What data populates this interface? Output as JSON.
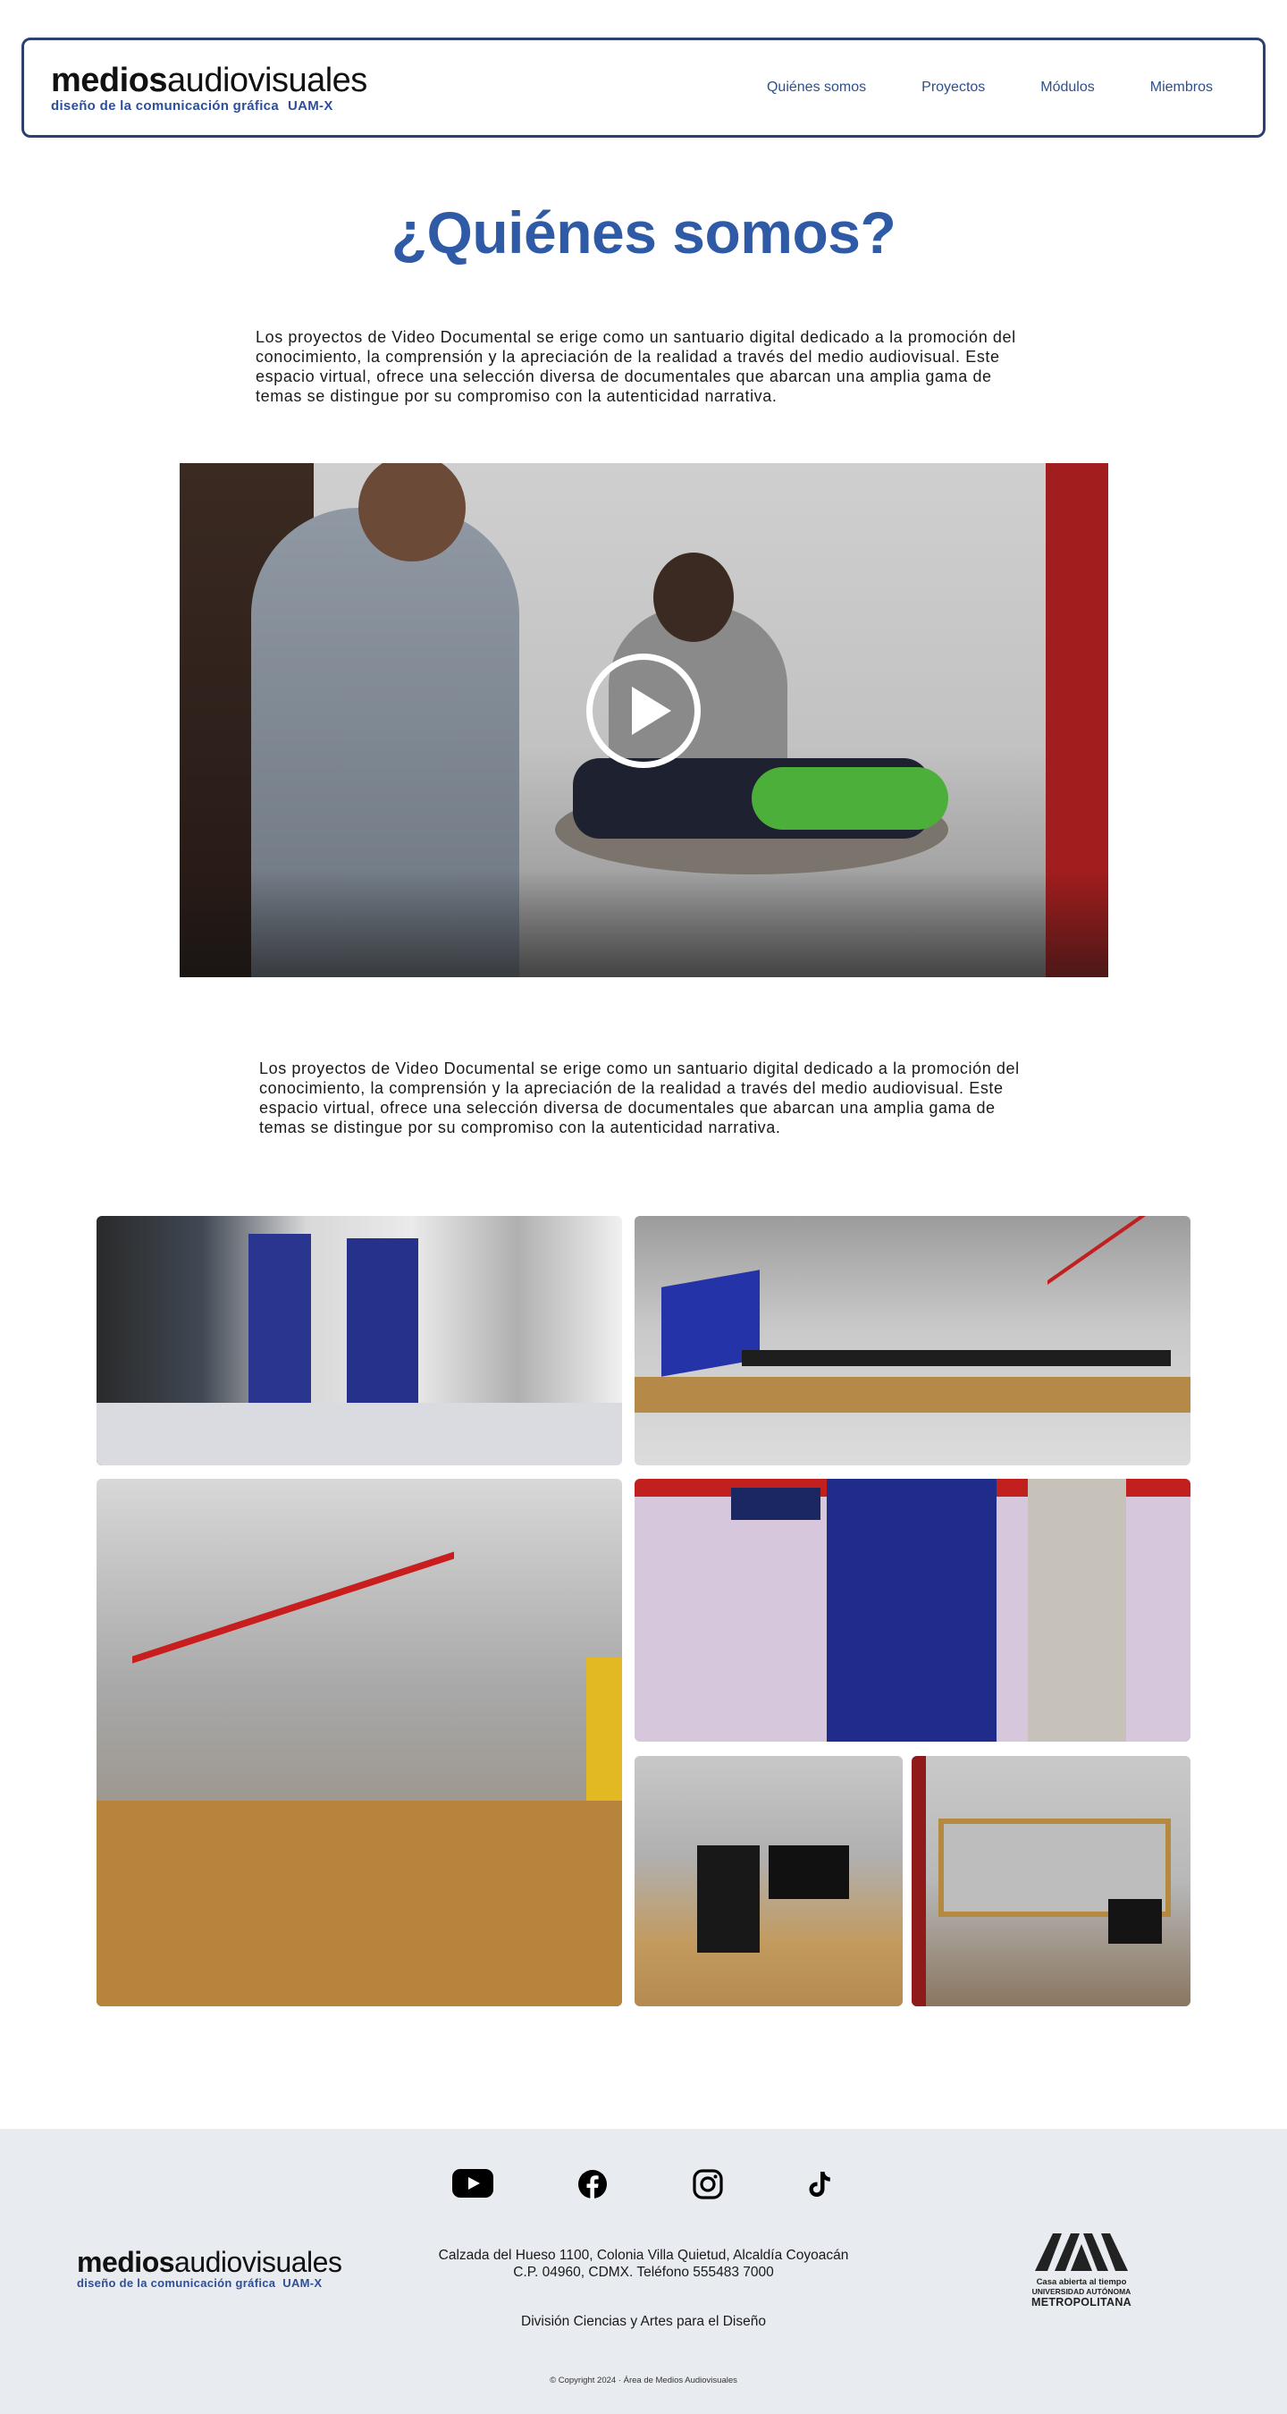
{
  "header": {
    "logo_bold": "medios",
    "logo_light": "audiovisuales",
    "logo_sub": "diseño de la comunicación gráfica",
    "logo_sub2": "UAM-X",
    "nav": [
      {
        "label": "Quiénes somos"
      },
      {
        "label": "Proyectos"
      },
      {
        "label": "Módulos"
      },
      {
        "label": "Miembros"
      }
    ]
  },
  "main": {
    "title": "¿Quiénes somos?",
    "paragraph_1": "Los proyectos de Video Documental se erige como un santuario digital dedicado a la promoción del conocimiento, la comprensión y la apreciación de la realidad a través del medio audiovisual. Este espacio virtual, ofrece una selección diversa de documentales que abarcan una amplia gama de temas se distingue por su compromiso con la autenticidad narrativa.",
    "paragraph_2": "Los proyectos de Video Documental se erige como un santuario digital dedicado a la promoción del conocimiento, la comprensión y la apreciación de la realidad a través del medio audiovisual. Este espacio virtual, ofrece una selección diversa de documentales que abarcan una amplia gama de temas se distingue por su compromiso con la autenticidad narrativa.",
    "video": {
      "icon": "play-icon"
    },
    "gallery_icons": [
      "photo-lab-hallway",
      "photo-classroom-desks",
      "photo-workshop-stairs",
      "photo-entrance-door",
      "photo-computer-lab",
      "photo-recording-booth"
    ]
  },
  "footer": {
    "social_icons": [
      "youtube-icon",
      "facebook-icon",
      "instagram-icon",
      "tiktok-icon"
    ],
    "logo_bold": "medios",
    "logo_light": "audiovisuales",
    "logo_sub": "diseño de la comunicación gráfica",
    "logo_sub2": "UAM-X",
    "address_line1": "Calzada del Hueso 1100, Colonia Villa Quietud, Alcaldía Coyoacán",
    "address_line2": "C.P. 04960, CDMX. Teléfono 555483 7000",
    "division": "División Ciencias y Artes para el Diseño",
    "copyright": "© Copyright 2024 · Área de Medios Audiovisuales",
    "uam_line1": "Casa abierta al tiempo",
    "uam_line2": "UNIVERSIDAD AUTÓNOMA",
    "uam_line3": "METROPOLITANA"
  },
  "colors": {
    "brand_blue": "#2f5aa6",
    "header_border": "#2b4170",
    "footer_bg": "#e8ebef"
  }
}
